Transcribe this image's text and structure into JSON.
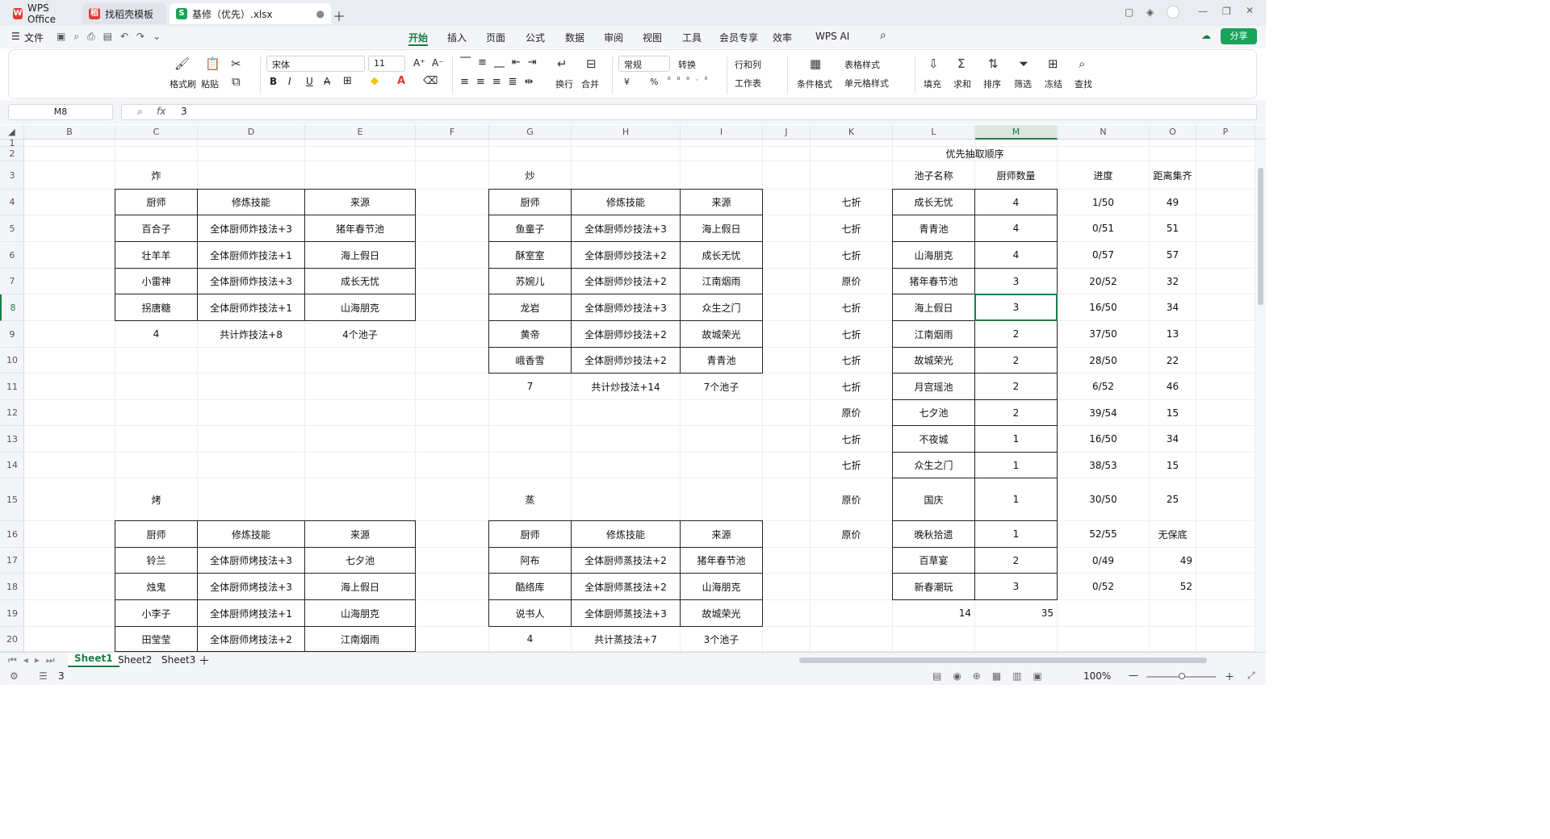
{
  "titlebar": {
    "wps": "WPS Office",
    "template": "找稻壳模板",
    "file": "基修（优先）.xlsx"
  },
  "menu": {
    "file": "文件",
    "items": [
      "开始",
      "插入",
      "页面",
      "公式",
      "数据",
      "审阅",
      "视图",
      "工具",
      "会员专享",
      "效率",
      "WPS AI"
    ],
    "share": "分享"
  },
  "ribbon": {
    "format_painter": "格式刷",
    "paste": "粘贴",
    "font_name": "宋体",
    "font_size": "11",
    "wrap": "换行",
    "merge": "合并",
    "number_format": "常规",
    "convert": "转换",
    "rows_cols": "行和列",
    "worksheet": "工作表",
    "cond_format": "条件格式",
    "table_style": "表格样式",
    "cell_style": "单元格样式",
    "fill": "填充",
    "sum": "求和",
    "sort": "排序",
    "filter": "筛选",
    "freeze": "冻结",
    "find": "查找",
    "currency": "¥",
    "percent": "%"
  },
  "formula": {
    "cell_ref": "M8",
    "fx": "fx",
    "value": "3"
  },
  "columns": [
    "B",
    "C",
    "D",
    "E",
    "F",
    "G",
    "H",
    "I",
    "J",
    "K",
    "L",
    "M",
    "N",
    "O",
    "P"
  ],
  "rows": [
    "1",
    "2",
    "3",
    "4",
    "5",
    "6",
    "7",
    "8",
    "9",
    "10",
    "11",
    "12",
    "13",
    "14",
    "15",
    "16",
    "17",
    "18",
    "19",
    "20"
  ],
  "cells": {
    "c3": "炸",
    "g3": "炒",
    "c15": "烤",
    "g15": "蒸",
    "hdr_chef": "厨师",
    "hdr_skill": "修炼技能",
    "hdr_src": "来源",
    "fry": [
      [
        "百合子",
        "全体厨师炸技法+3",
        "猪年春节池"
      ],
      [
        "壮羊羊",
        "全体厨师炸技法+1",
        "海上假日"
      ],
      [
        "小雷神",
        "全体厨师炸技法+3",
        "成长无忧"
      ],
      [
        "拐唐糖",
        "全体厨师炸技法+1",
        "山海朋克"
      ]
    ],
    "fry_total": [
      "4",
      "共计炸技法+8",
      "4个池子"
    ],
    "stir": [
      [
        "鱼童子",
        "全体厨师炒技法+3",
        "海上假日"
      ],
      [
        "酥室室",
        "全体厨师炒技法+2",
        "成长无忧"
      ],
      [
        "苏婉儿",
        "全体厨师炒技法+2",
        "江南烟雨"
      ],
      [
        "龙岩",
        "全体厨师炒技法+3",
        "众生之门"
      ],
      [
        "黄帝",
        "全体厨师炒技法+2",
        "故城荣光"
      ],
      [
        "峨香雪",
        "全体厨师炒技法+2",
        "青青池"
      ]
    ],
    "stir_total": [
      "7",
      "共计炒技法+14",
      "7个池子"
    ],
    "roast": [
      [
        "铃兰",
        "全体厨师烤技法+3",
        "七夕池"
      ],
      [
        "烛鬼",
        "全体厨师烤技法+3",
        "海上假日"
      ],
      [
        "小李子",
        "全体厨师烤技法+1",
        "山海朋克"
      ],
      [
        "田莹莹",
        "全体厨师烤技法+2",
        "江南烟雨"
      ]
    ],
    "steam": [
      [
        "阿布",
        "全体厨师蒸技法+2",
        "猪年春节池"
      ],
      [
        "酷络库",
        "全体厨师蒸技法+2",
        "山海朋克"
      ],
      [
        "说书人",
        "全体厨师蒸技法+3",
        "故城荣光"
      ]
    ],
    "steam_total": [
      "4",
      "共计蒸技法+7",
      "3个池子"
    ],
    "priority_title": "优先抽取顺序",
    "pool_hdr": [
      "池子名称",
      "厨师数量",
      "进度",
      "距离集齐"
    ],
    "pools": [
      [
        "七折",
        "成长无忧",
        "4",
        "1/50",
        "49"
      ],
      [
        "七折",
        "青青池",
        "4",
        "0/51",
        "51"
      ],
      [
        "七折",
        "山海朋克",
        "4",
        "0/57",
        "57"
      ],
      [
        "原价",
        "猪年春节池",
        "3",
        "20/52",
        "32"
      ],
      [
        "七折",
        "海上假日",
        "3",
        "16/50",
        "34"
      ],
      [
        "七折",
        "江南烟雨",
        "2",
        "37/50",
        "13"
      ],
      [
        "七折",
        "故城荣光",
        "2",
        "28/50",
        "22"
      ],
      [
        "七折",
        "月宫瑶池",
        "2",
        "6/52",
        "46"
      ],
      [
        "原价",
        "七夕池",
        "2",
        "39/54",
        "15"
      ],
      [
        "七折",
        "不夜城",
        "1",
        "16/50",
        "34"
      ],
      [
        "七折",
        "众生之门",
        "1",
        "38/53",
        "15"
      ],
      [
        "原价",
        "国庆",
        "1",
        "30/50",
        "25"
      ],
      [
        "原价",
        "晚秋拾遗",
        "1",
        "52/55",
        "无保底"
      ],
      [
        "",
        "百草宴",
        "2",
        "0/49",
        "49"
      ],
      [
        "",
        "新春潮玩",
        "3",
        "0/52",
        "52"
      ]
    ],
    "sum_l": "14",
    "sum_m": "35"
  },
  "sheets": [
    "Sheet1",
    "Sheet2",
    "Sheet3"
  ],
  "status": {
    "count": "3",
    "zoom": "100%"
  },
  "colors": {
    "accent": "#1aa35a",
    "select": "#1a7f45"
  }
}
